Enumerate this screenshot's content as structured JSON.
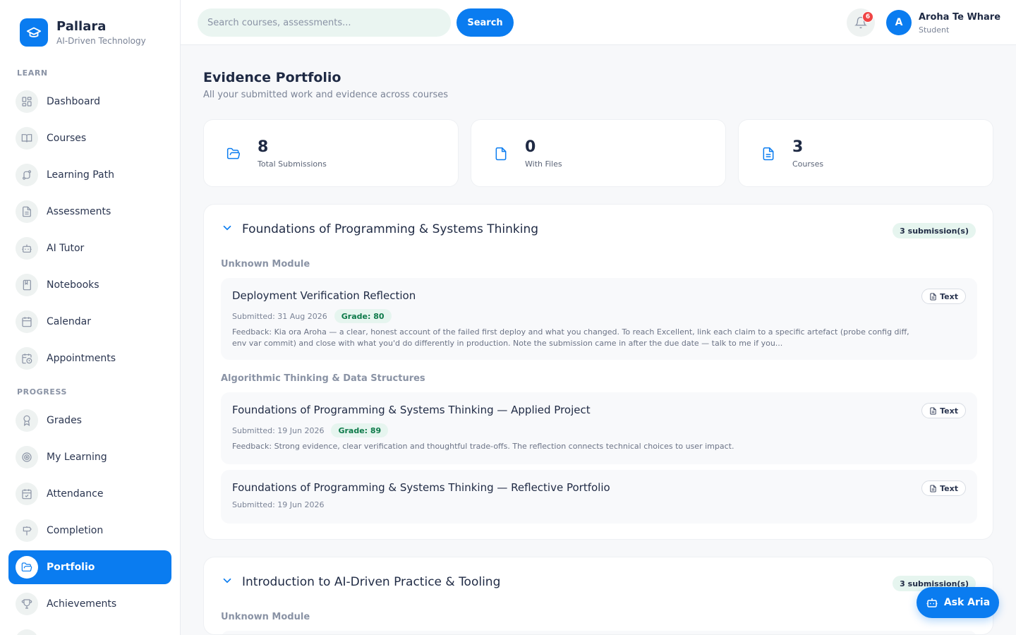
{
  "brand": {
    "name": "Pallara",
    "subtitle": "AI-Driven Technology"
  },
  "sidebar": {
    "sections": [
      "LEARN",
      "PROGRESS"
    ],
    "learn": [
      {
        "label": "Dashboard",
        "icon": "dashboard-icon"
      },
      {
        "label": "Courses",
        "icon": "book-icon"
      },
      {
        "label": "Learning Path",
        "icon": "route-icon"
      },
      {
        "label": "Assessments",
        "icon": "document-icon"
      },
      {
        "label": "AI Tutor",
        "icon": "robot-icon"
      },
      {
        "label": "Notebooks",
        "icon": "notebook-icon"
      },
      {
        "label": "Calendar",
        "icon": "calendar-icon"
      },
      {
        "label": "Appointments",
        "icon": "calendar-clock-icon"
      }
    ],
    "progress": [
      {
        "label": "Grades",
        "icon": "award-icon"
      },
      {
        "label": "My Learning",
        "icon": "target-icon"
      },
      {
        "label": "Attendance",
        "icon": "calendar-check-icon"
      },
      {
        "label": "Completion",
        "icon": "signpost-icon"
      },
      {
        "label": "Portfolio",
        "icon": "folder-open-icon",
        "active": true
      },
      {
        "label": "Achievements",
        "icon": "trophy-icon"
      }
    ]
  },
  "topbar": {
    "search_placeholder": "Search courses, assessments...",
    "search_button": "Search",
    "notification_count": "6",
    "user": {
      "initial": "A",
      "name": "Aroha Te Whare",
      "role": "Student"
    }
  },
  "page": {
    "title": "Evidence Portfolio",
    "subtitle": "All your submitted work and evidence across courses"
  },
  "stats": [
    {
      "value": "8",
      "label": "Total Submissions",
      "icon": "folder-open-icon"
    },
    {
      "value": "0",
      "label": "With Files",
      "icon": "file-icon"
    },
    {
      "value": "3",
      "label": "Courses",
      "icon": "file-text-icon"
    }
  ],
  "courses": [
    {
      "title": "Foundations of Programming & Systems Thinking",
      "count": "3 submission(s)",
      "modules": [
        {
          "name": "Unknown Module",
          "items": [
            {
              "title": "Deployment Verification Reflection",
              "submitted": "Submitted: 31 Aug 2026",
              "grade": "Grade: 80",
              "feedback": "Feedback: Kia ora Aroha — a clear, honest account of the failed first deploy and what you changed. To reach Excellent, link each claim to a specific artefact (probe config diff, env var commit) and close with what you'd do differently in production. Note the submission came in after the due date — talk to me if you...",
              "type": "Text"
            }
          ]
        },
        {
          "name": "Algorithmic Thinking & Data Structures",
          "items": [
            {
              "title": "Foundations of Programming & Systems Thinking — Applied Project",
              "submitted": "Submitted: 19 Jun 2026",
              "grade": "Grade: 89",
              "feedback": "Feedback: Strong evidence, clear verification and thoughtful trade-offs. The reflection connects technical choices to user impact.",
              "type": "Text"
            },
            {
              "title": "Foundations of Programming & Systems Thinking — Reflective Portfolio",
              "submitted": "Submitted: 19 Jun 2026",
              "type": "Text"
            }
          ]
        }
      ]
    },
    {
      "title": "Introduction to AI-Driven Practice & Tooling",
      "count": "3 submission(s)",
      "modules": [
        {
          "name": "Unknown Module"
        }
      ]
    }
  ],
  "assistant": {
    "label": "Ask Aria"
  },
  "colors": {
    "accent": "#0a7cf0",
    "grade_bg": "#e6f5ef",
    "grade_text": "#0e7a4a",
    "badge_red": "#ef4444"
  }
}
